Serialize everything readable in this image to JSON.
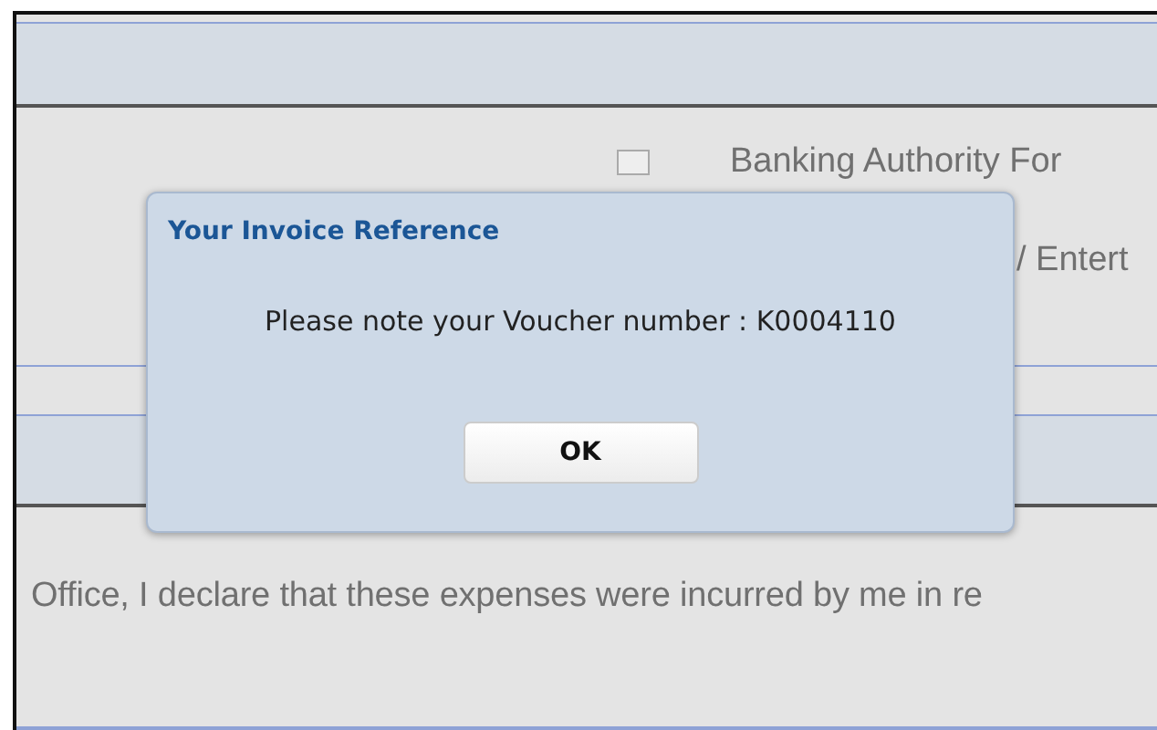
{
  "form": {
    "option_label": "Banking Authority For",
    "option_checked": false,
    "second_label": "/ Entert",
    "declaration": "Office, I declare that these expenses were incurred by me in re"
  },
  "dialog": {
    "title": "Your Invoice Reference",
    "message": "Please note your Voucher number : K0004110",
    "button": "OK"
  }
}
